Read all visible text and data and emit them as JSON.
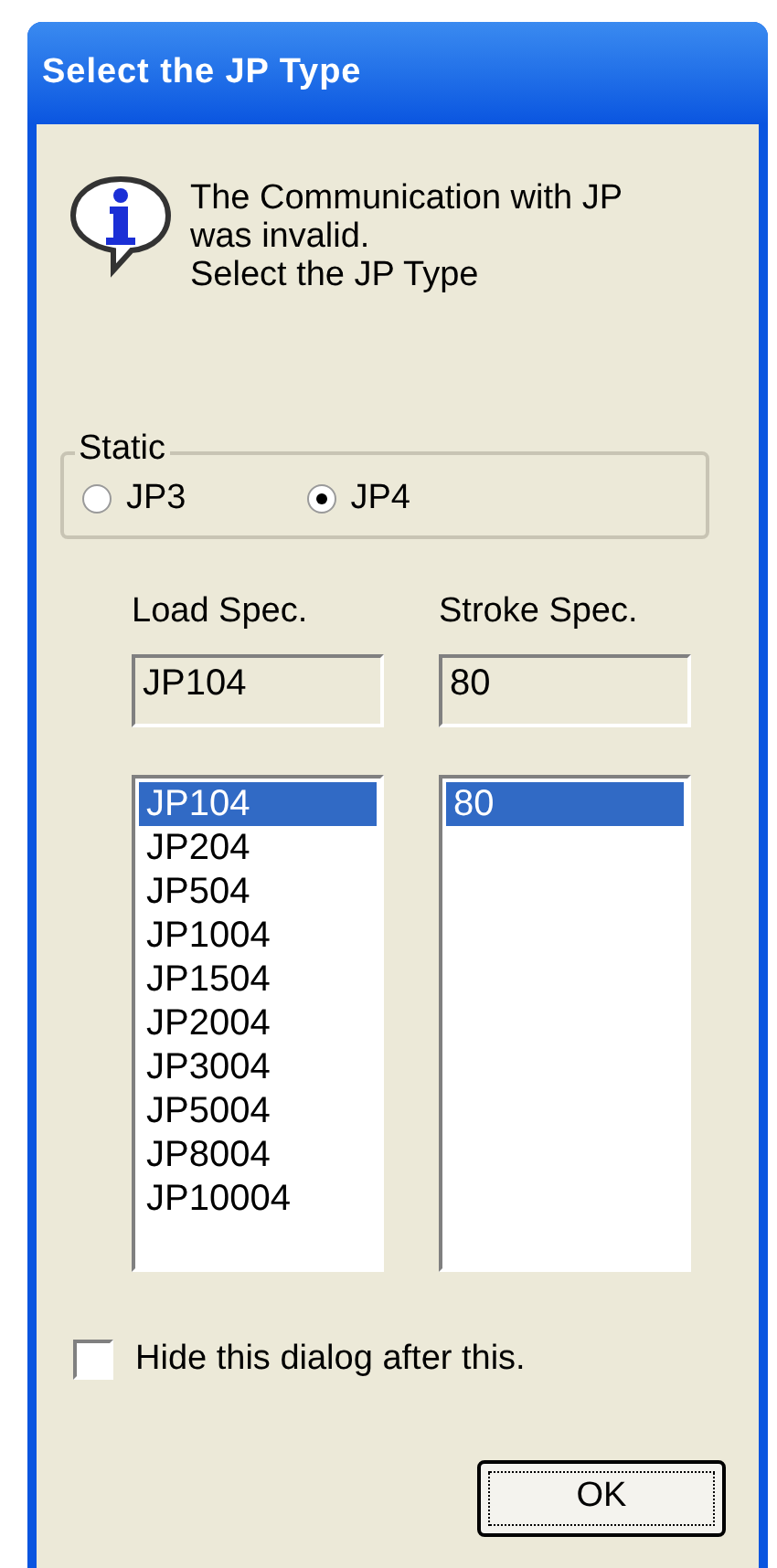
{
  "window": {
    "title": "Select the JP Type"
  },
  "message": [
    "The Communication with JP",
    "was invalid.",
    "Select the JP Type"
  ],
  "group": {
    "label": "Static",
    "radios": [
      {
        "label": "JP3",
        "selected": false
      },
      {
        "label": "JP4",
        "selected": true
      }
    ]
  },
  "load_spec": {
    "label": "Load Spec.",
    "value": "JP104",
    "items": [
      {
        "label": "JP104",
        "selected": true
      },
      {
        "label": "JP204",
        "selected": false
      },
      {
        "label": "JP504",
        "selected": false
      },
      {
        "label": "JP1004",
        "selected": false
      },
      {
        "label": "JP1504",
        "selected": false
      },
      {
        "label": "JP2004",
        "selected": false
      },
      {
        "label": "JP3004",
        "selected": false
      },
      {
        "label": "JP5004",
        "selected": false
      },
      {
        "label": "JP8004",
        "selected": false
      },
      {
        "label": "JP10004",
        "selected": false
      }
    ]
  },
  "stroke_spec": {
    "label": "Stroke Spec.",
    "value": "80",
    "items": [
      {
        "label": "80",
        "selected": true
      }
    ]
  },
  "hide_checkbox": {
    "label": "Hide this dialog after this.",
    "checked": false
  },
  "ok_button": {
    "label": "OK"
  }
}
